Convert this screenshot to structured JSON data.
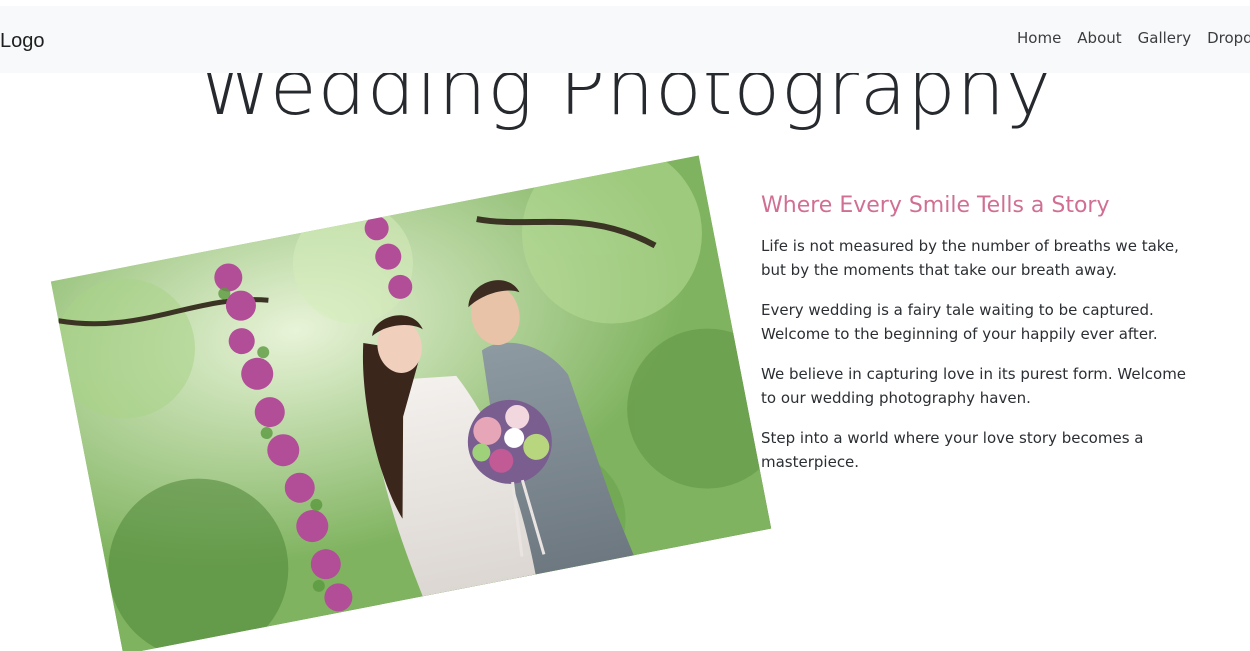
{
  "hero": {
    "title": "Wedding Photography"
  },
  "navbar": {
    "brand": "Logo",
    "links": [
      "Home",
      "About",
      "Gallery",
      "Dropdown"
    ]
  },
  "story": {
    "heading": "Where Every Smile Tells a Story",
    "paragraphs": [
      "Life is not measured by the number of breaths we take, but by the moments that take our breath away.",
      "Every wedding is a fairy tale waiting to be captured. Welcome to the beginning of your happily ever after.",
      "We believe in capturing love in its purest form. Welcome to our wedding photography haven.",
      "Step into a world where your love story becomes a masterpiece."
    ]
  },
  "colors": {
    "accent_heading": "#d06f93",
    "navbar_bg": "#f8f9fa",
    "text": "#212529"
  },
  "icons": {
    "photo": "wedding-couple-photo"
  }
}
